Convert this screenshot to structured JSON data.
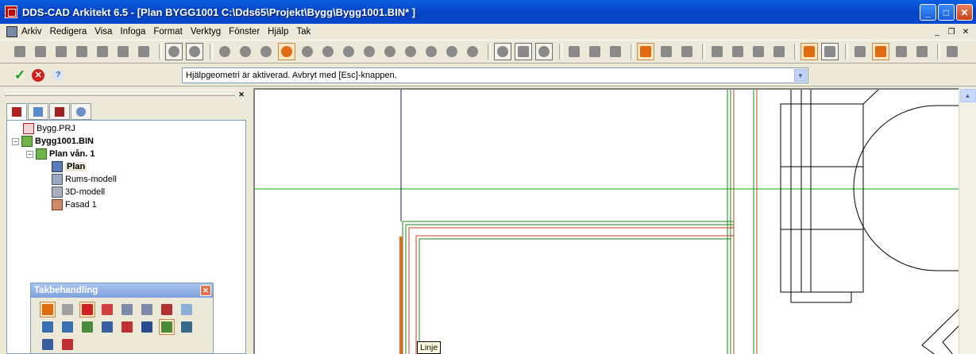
{
  "window": {
    "title": "DDS-CAD Arkitekt 6.5 - [Plan  BYGG1001  C:\\Dds65\\Projekt\\Bygg\\Bygg1001.BIN* ]",
    "controls": {
      "minimize": "_",
      "maximize": "□",
      "close": "✕"
    }
  },
  "menubar": {
    "items": [
      "Arkiv",
      "Redigera",
      "Visa",
      "Infoga",
      "Format",
      "Verktyg",
      "Fönster",
      "Hjälp",
      "Tak"
    ],
    "mdi_controls": {
      "minimize": "_",
      "restore": "❐",
      "close": "✕"
    }
  },
  "command_bar": {
    "prompt_text": "Hjälpgeometri är aktiverad. Avbryt med [Esc]-knappen.",
    "accept_icon": "check-icon",
    "cancel_icon": "cancel-icon",
    "help_icon": "help-icon"
  },
  "project_tree": {
    "close_glyph": "✕",
    "tabs": [
      "tree-view-tab",
      "layers-tab",
      "views-tab",
      "help-tab"
    ],
    "nodes": [
      {
        "label": "Bygg.PRJ",
        "bold": false,
        "expander": ""
      },
      {
        "label": "Bygg1001.BIN",
        "bold": true,
        "expander": "−"
      },
      {
        "label": "Plan vån. 1",
        "bold": true,
        "expander": "−"
      },
      {
        "label": "Plan",
        "bold": true,
        "selected": true,
        "expander": ""
      },
      {
        "label": "Rums-modell",
        "bold": false,
        "expander": ""
      },
      {
        "label": "3D-modell",
        "bold": false,
        "expander": ""
      },
      {
        "label": "Fasad 1",
        "bold": false,
        "expander": ""
      }
    ]
  },
  "roof_toolbar": {
    "title": "Takbehandling",
    "close_glyph": "✕",
    "active_tool_index": 2,
    "second_active_index": 12
  },
  "tooltip": {
    "text": "Linje"
  },
  "scrollbar": {
    "up_arrow": "▲"
  },
  "colors": {
    "title_blue": "#0a5fe0",
    "active_tool": "#fbe6c4",
    "guide_line": "#00b000",
    "wall_red": "#c0401a",
    "wall_green": "#1a8a1a",
    "highlight_orange": "#e86a20"
  }
}
